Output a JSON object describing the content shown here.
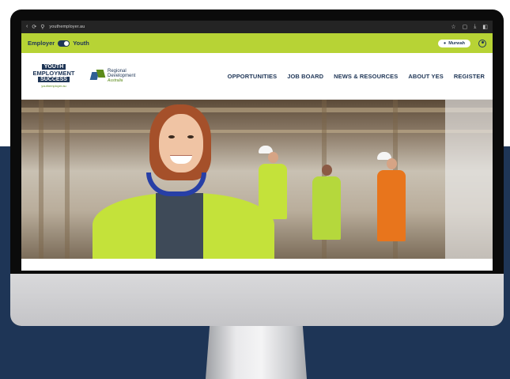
{
  "browser": {
    "url": "youthemployer.au"
  },
  "toggle": {
    "left_label": "Employer",
    "right_label": "Youth"
  },
  "location": {
    "label": "Murwah"
  },
  "logos": {
    "yes_line1": "YOUTH",
    "yes_line2": "EMPLOYMENT",
    "yes_line3": "SUCCESS",
    "yes_url": "youthemployer.au",
    "rda_line1": "Regional",
    "rda_line2": "Development",
    "rda_line3": "Australia"
  },
  "nav": {
    "items": [
      "OPPORTUNITIES",
      "JOB BOARD",
      "NEWS & RESOURCES",
      "ABOUT YES",
      "REGISTER"
    ]
  },
  "colors": {
    "navy": "#1e3556",
    "lime": "#b7d335",
    "vest": "#c4e23a",
    "orange_vest": "#e8751c"
  },
  "icons": {
    "location": "map-pin-icon",
    "account": "user-circle-icon"
  }
}
